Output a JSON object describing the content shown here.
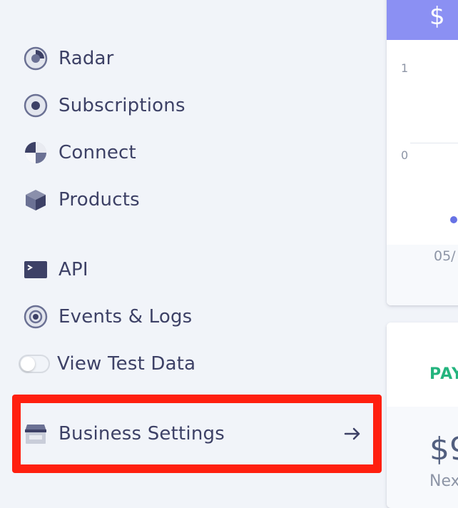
{
  "sidebar": {
    "items": [
      {
        "label": "Radar",
        "icon": "radar-icon"
      },
      {
        "label": "Subscriptions",
        "icon": "subscriptions-icon"
      },
      {
        "label": "Connect",
        "icon": "connect-icon"
      },
      {
        "label": "Products",
        "icon": "products-icon"
      },
      {
        "label": "API",
        "icon": "api-terminal-icon"
      },
      {
        "label": "Events & Logs",
        "icon": "events-icon"
      }
    ],
    "test_data": {
      "label": "View Test Data",
      "enabled": false
    },
    "business_settings": {
      "label": "Business Settings",
      "icon": "storefront-icon",
      "arrow_icon": "arrow-right-icon"
    }
  },
  "chart_card": {
    "header_text": "$",
    "y_ticks": [
      "1",
      "0"
    ],
    "x_tick": "05/"
  },
  "payments_card": {
    "tab_label": "PAY",
    "amount": "$9",
    "sub_label": "Nex"
  },
  "colors": {
    "sidebar_bg": "#f1f4f9",
    "text": "#3d4166",
    "icon": "#6b7194",
    "header_purple": "#8b90f3",
    "highlight_red": "#ff1f0f",
    "tab_green": "#24b47e",
    "dot_purple": "#6772e5"
  }
}
